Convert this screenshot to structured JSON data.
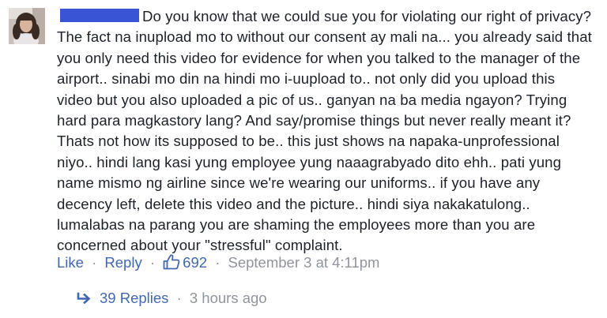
{
  "comment": {
    "text": "Do you know that we could sue you for violating our right of privacy? The fact na inupload mo to without our consent ay mali na... you already said that you only need this video for evidence for when you talked to the manager of the airport.. sinabi mo din na hindi mo i-uupload to.. not only did you upload this video but you also uploaded a pic of us.. ganyan na ba media ngayon? Trying hard para magkastory lang? And say/promise things but never really meant it? Thats not how its supposed to be.. this just shows na napaka-unprofessional niyo.. hindi lang kasi yung employee yung naaagrabyado dito ehh.. pati yung name mismo ng airline since we're wearing our uniforms.. if you have any decency left, delete this video and the picture.. hindi siya nakakatulong.. lumalabas na parang you are shaming the employees more than you are concerned about your \"stressful\" complaint.",
    "redaction_color": "#3a54d6"
  },
  "actions": {
    "like_label": "Like",
    "reply_label": "Reply",
    "separator": "·",
    "like_count": "692",
    "timestamp": "September 3 at 4:11pm",
    "link_color": "#4267b2",
    "meta_color": "#90949c"
  },
  "replies": {
    "label": "39 Replies",
    "separator": "·",
    "time": "3 hours ago",
    "icon": "reply-arrow-icon"
  },
  "icons": {
    "like": "thumbs-up-icon",
    "reply": "reply-arrow-icon"
  }
}
